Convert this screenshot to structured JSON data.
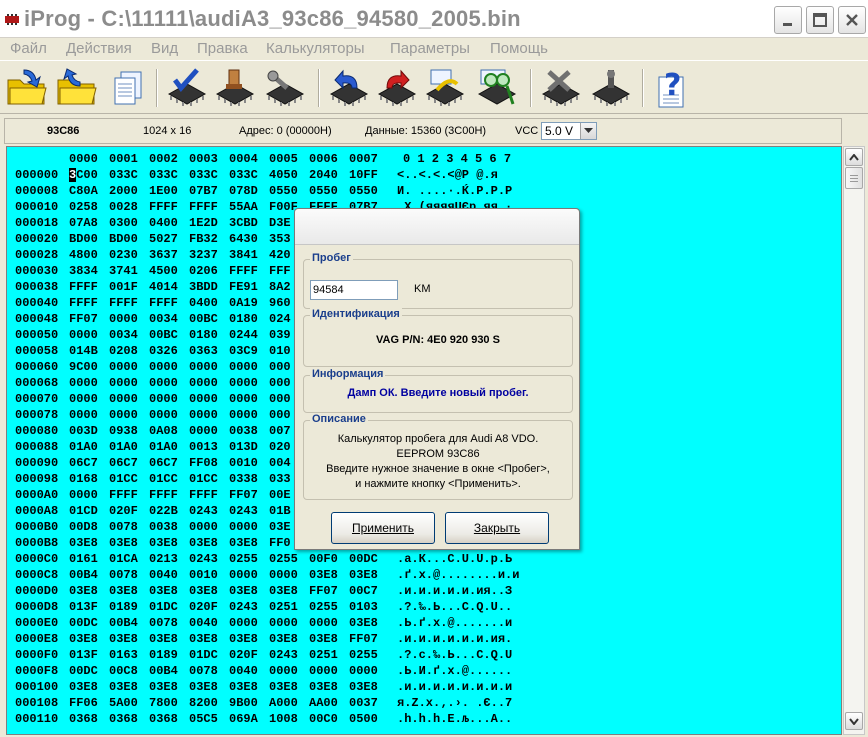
{
  "window": {
    "title": "iProg - C:\\11111\\audiA3_93c86_94580_2005.bin"
  },
  "menu": [
    "Файл",
    "Действия",
    "Вид",
    "Правка",
    "Калькуляторы",
    "Параметры",
    "Помощь"
  ],
  "toolbar": {
    "buttons": [
      "open-folder",
      "save-folder",
      "copy-pages",
      "read-chip",
      "write-chip",
      "erase-chip",
      "undo-chip",
      "redo-chip",
      "edit-chip",
      "verify-chip",
      "settings-chip",
      "probe-chip",
      "help"
    ]
  },
  "info": {
    "chip": "93C86",
    "size": "1024 x 16",
    "address": "Адрес: 0 (00000H)",
    "data": "Данные: 15360 (3C00H)",
    "vcc_label": "VCC",
    "vcc_value": "5.0 V"
  },
  "hex": {
    "columns": [
      "0000",
      "0001",
      "0002",
      "0003",
      "0004",
      "0005",
      "0006",
      "0007"
    ],
    "ascii_header": "0 1 2 3 4 5 6 7",
    "rows": [
      {
        "addr": "000000",
        "cells": [
          "3C00",
          "033C",
          "033C",
          "033C",
          "033C",
          "4050",
          "2040",
          "10FF"
        ],
        "ascii": "<..<.<.<@P @.я"
      },
      {
        "addr": "000008",
        "cells": [
          "C80A",
          "2000",
          "1E00",
          "07B7",
          "078D",
          "0550",
          "0550",
          "0550"
        ],
        "ascii": "И. ....·.Ќ.P.P.P"
      },
      {
        "addr": "000010",
        "cells": [
          "0258",
          "0028",
          "FFFF",
          "FFFF",
          "55AA",
          "F00F",
          "FFFF",
          "07B7"
        ],
        "ascii": ".X.(яяяяUЄр.яя.·"
      },
      {
        "addr": "000018",
        "cells": [
          "07A8",
          "0300",
          "0400",
          "1E2D",
          "3CBD",
          "D3E",
          "",
          ""
        ],
        "ascii": ""
      },
      {
        "addr": "000020",
        "cells": [
          "BD00",
          "BD00",
          "5027",
          "FB32",
          "6430",
          "353",
          "",
          ""
        ],
        "ascii": ""
      },
      {
        "addr": "000028",
        "cells": [
          "4800",
          "0230",
          "3637",
          "3237",
          "3841",
          "420",
          "",
          ""
        ],
        "ascii": ""
      },
      {
        "addr": "000030",
        "cells": [
          "3834",
          "3741",
          "4500",
          "0206",
          "FFFF",
          "FFF",
          "",
          ""
        ],
        "ascii": ""
      },
      {
        "addr": "000038",
        "cells": [
          "FFFF",
          "001F",
          "4014",
          "3BDD",
          "FE91",
          "8A2",
          "",
          ""
        ],
        "ascii": ""
      },
      {
        "addr": "000040",
        "cells": [
          "FFFF",
          "FFFF",
          "FFFF",
          "0400",
          "0A19",
          "960",
          "",
          ""
        ],
        "ascii": ""
      },
      {
        "addr": "000048",
        "cells": [
          "FF07",
          "0000",
          "0034",
          "00BC",
          "0180",
          "024",
          "",
          ""
        ],
        "ascii": ""
      },
      {
        "addr": "000050",
        "cells": [
          "0000",
          "0034",
          "00BC",
          "0180",
          "0244",
          "039",
          "",
          ""
        ],
        "ascii": ""
      },
      {
        "addr": "000058",
        "cells": [
          "014B",
          "0208",
          "0326",
          "0363",
          "03C9",
          "010",
          "",
          ""
        ],
        "ascii": ""
      },
      {
        "addr": "000060",
        "cells": [
          "9C00",
          "0000",
          "0000",
          "0000",
          "0000",
          "000",
          "",
          ""
        ],
        "ascii": ""
      },
      {
        "addr": "000068",
        "cells": [
          "0000",
          "0000",
          "0000",
          "0000",
          "0000",
          "000",
          "",
          ""
        ],
        "ascii": ""
      },
      {
        "addr": "000070",
        "cells": [
          "0000",
          "0000",
          "0000",
          "0000",
          "0000",
          "000",
          "",
          ""
        ],
        "ascii": ""
      },
      {
        "addr": "000078",
        "cells": [
          "0000",
          "0000",
          "0000",
          "0000",
          "0000",
          "000",
          "",
          ""
        ],
        "ascii": ""
      },
      {
        "addr": "000080",
        "cells": [
          "003D",
          "0938",
          "0A08",
          "0000",
          "0038",
          "007",
          "",
          ""
        ],
        "ascii": ""
      },
      {
        "addr": "000088",
        "cells": [
          "01A0",
          "01A0",
          "01A0",
          "0013",
          "013D",
          "020",
          "",
          ""
        ],
        "ascii": ""
      },
      {
        "addr": "000090",
        "cells": [
          "06C7",
          "06C7",
          "06C7",
          "FF08",
          "0010",
          "004",
          "",
          ""
        ],
        "ascii": ""
      },
      {
        "addr": "000098",
        "cells": [
          "0168",
          "01CC",
          "01CC",
          "01CC",
          "0338",
          "033",
          "",
          ""
        ],
        "ascii": ""
      },
      {
        "addr": "0000A0",
        "cells": [
          "0000",
          "FFFF",
          "FFFF",
          "FFFF",
          "FF07",
          "00E",
          "",
          ""
        ],
        "ascii": ""
      },
      {
        "addr": "0000A8",
        "cells": [
          "01CD",
          "020F",
          "022B",
          "0243",
          "0243",
          "01B",
          "",
          ""
        ],
        "ascii": ""
      },
      {
        "addr": "0000B0",
        "cells": [
          "00D8",
          "0078",
          "0038",
          "0000",
          "0000",
          "03E",
          "",
          ""
        ],
        "ascii": ""
      },
      {
        "addr": "0000B8",
        "cells": [
          "03E8",
          "03E8",
          "03E8",
          "03E8",
          "03E8",
          "FF0",
          "",
          ""
        ],
        "ascii": ""
      },
      {
        "addr": "0000C0",
        "cells": [
          "0161",
          "01CA",
          "0213",
          "0243",
          "0255",
          "0255",
          "00F0",
          "00DC"
        ],
        "ascii": ".a.К...C.U.U.р.Ь"
      },
      {
        "addr": "0000C8",
        "cells": [
          "00B4",
          "0078",
          "0040",
          "0010",
          "0000",
          "0000",
          "03E8",
          "03E8"
        ],
        "ascii": ".ґ.x.@........и.и"
      },
      {
        "addr": "0000D0",
        "cells": [
          "03E8",
          "03E8",
          "03E8",
          "03E8",
          "03E8",
          "03E8",
          "FF07",
          "00C7"
        ],
        "ascii": ".и.и.и.и.и.ия..З"
      },
      {
        "addr": "0000D8",
        "cells": [
          "013F",
          "0189",
          "01DC",
          "020F",
          "0243",
          "0251",
          "0255",
          "0103"
        ],
        "ascii": ".?.‰.Ь...C.Q.U.."
      },
      {
        "addr": "0000E0",
        "cells": [
          "00DC",
          "00B4",
          "0078",
          "0040",
          "0000",
          "0000",
          "0000",
          "03E8"
        ],
        "ascii": ".Ь.ґ.x.@.......и"
      },
      {
        "addr": "0000E8",
        "cells": [
          "03E8",
          "03E8",
          "03E8",
          "03E8",
          "03E8",
          "03E8",
          "03E8",
          "FF07"
        ],
        "ascii": ".и.и.и.и.и.и.ия."
      },
      {
        "addr": "0000F0",
        "cells": [
          "013F",
          "0163",
          "0189",
          "01DC",
          "020F",
          "0243",
          "0251",
          "0255"
        ],
        "ascii": ".?.c.‰.Ь...C.Q.U"
      },
      {
        "addr": "0000F8",
        "cells": [
          "00DC",
          "00C8",
          "00B4",
          "0078",
          "0040",
          "0000",
          "0000",
          "0000"
        ],
        "ascii": ".Ь.И.ґ.x.@......"
      },
      {
        "addr": "000100",
        "cells": [
          "03E8",
          "03E8",
          "03E8",
          "03E8",
          "03E8",
          "03E8",
          "03E8",
          "03E8"
        ],
        "ascii": ".и.и.и.и.и.и.и.и"
      },
      {
        "addr": "000108",
        "cells": [
          "FF06",
          "5A00",
          "7800",
          "8200",
          "9B00",
          "A000",
          "AA00",
          "0037"
        ],
        "ascii": "я.Z.x.‚.›. .Є..7"
      },
      {
        "addr": "000110",
        "cells": [
          "0368",
          "0368",
          "0368",
          "05C5",
          "069A",
          "1008",
          "00C0",
          "0500"
        ],
        "ascii": ".h.h.h.Е.љ...А.."
      }
    ]
  },
  "dialog": {
    "mileage_legend": "Пробег",
    "mileage_value": "94584",
    "mileage_unit": "KM",
    "id_legend": "Идентификация",
    "id_text": "VAG P/N: 4E0 920 930 S",
    "info_legend": "Информация",
    "info_text": "Дамп ОК. Введите новый пробег.",
    "desc_legend": "Описание",
    "desc_lines": [
      "Калькулятор пробега для Audi A8 VDO.",
      "EEPROM 93C86",
      "Введите нужное значение в окне <Пробег>,",
      "и нажмите кнопку <Применить>."
    ],
    "apply_label": "Применить",
    "close_label": "Закрыть"
  },
  "colors": {
    "hex_bg": "#00ffff",
    "legend": "#1a3e8c",
    "info_text": "#0000a0"
  }
}
